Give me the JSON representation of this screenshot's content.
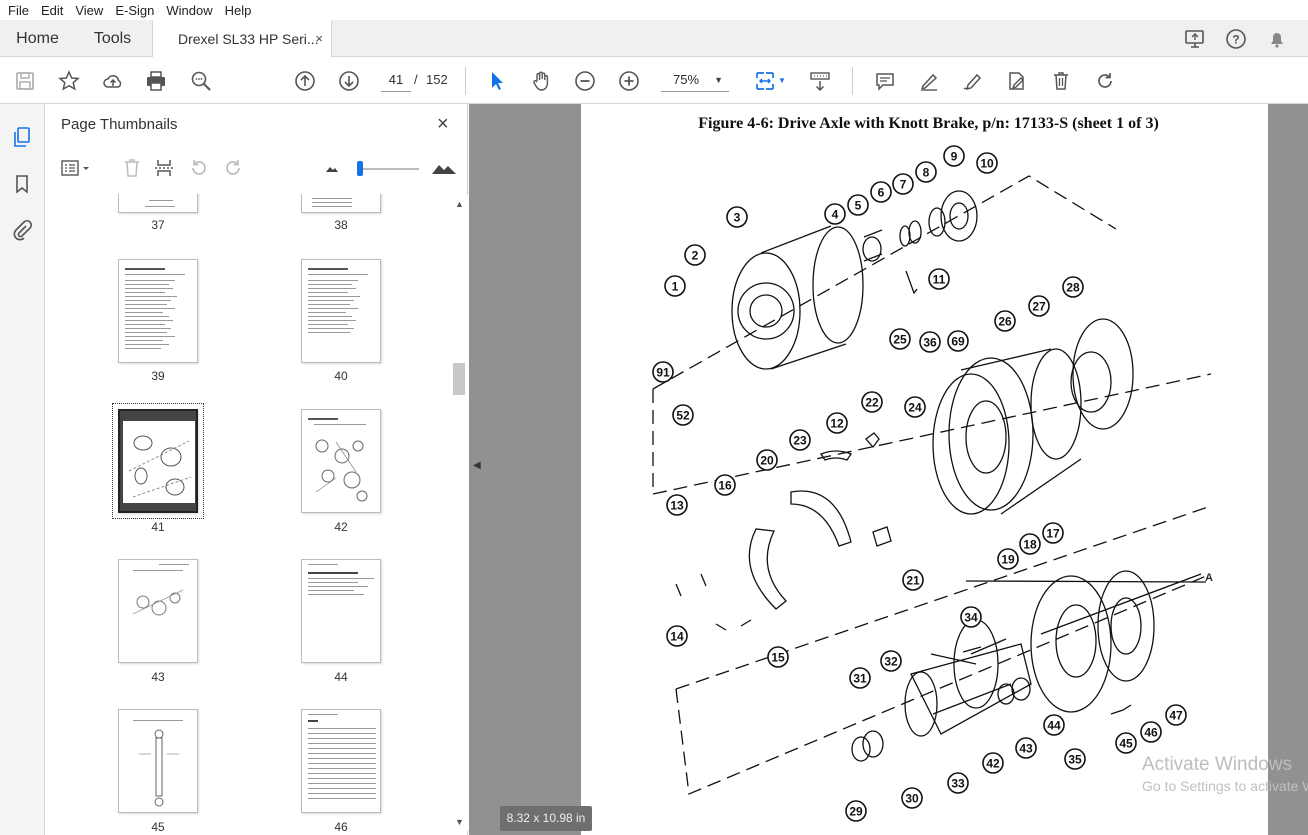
{
  "menu": [
    "File",
    "Edit",
    "View",
    "E-Sign",
    "Window",
    "Help"
  ],
  "tabs": {
    "home": "Home",
    "tools": "Tools",
    "document": "Drexel SL33 HP Seri...",
    "close": "×"
  },
  "toolbar": {
    "current_page": "41",
    "page_sep": "/",
    "total_pages": "152",
    "zoom": "75%"
  },
  "panel": {
    "title": "Page Thumbnails",
    "close": "×"
  },
  "thumbnails": [
    "37",
    "38",
    "39",
    "40",
    "41",
    "42",
    "43",
    "44",
    "45",
    "46"
  ],
  "document": {
    "figure_title": "Figure 4-6:  Drive Axle with Knott Brake, p/n: 17133-S (sheet 1 of 3)",
    "page_size": "8.32 x 10.98 in",
    "callouts": [
      "1",
      "2",
      "3",
      "4",
      "5",
      "6",
      "7",
      "8",
      "9",
      "10",
      "11",
      "12",
      "13",
      "14",
      "15",
      "16",
      "17",
      "18",
      "19",
      "20",
      "21",
      "22",
      "23",
      "24",
      "25",
      "26",
      "27",
      "28",
      "29",
      "30",
      "31",
      "32",
      "33",
      "34",
      "35",
      "36",
      "42",
      "43",
      "44",
      "45",
      "46",
      "47",
      "52",
      "69",
      "91"
    ],
    "section_marker": "A"
  },
  "watermark": {
    "line1": "Activate Windows",
    "line2": "Go to Settings to activate Windows."
  },
  "colors": {
    "accent": "#1473e6",
    "viewer_bg": "#919191"
  }
}
